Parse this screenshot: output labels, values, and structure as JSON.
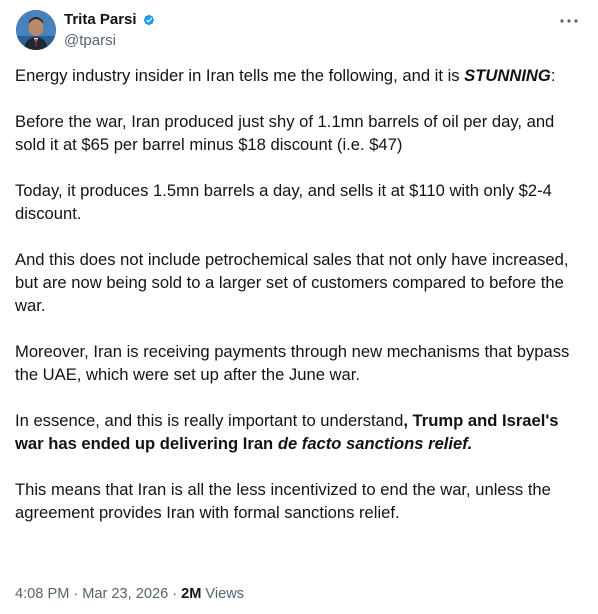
{
  "author": {
    "display_name": "Trita Parsi",
    "handle": "@tparsi",
    "verified": true,
    "verified_color": "#1d9bf0"
  },
  "icons": {
    "more": "more-horizontal-icon",
    "verified": "verified-badge-icon"
  },
  "tweet": {
    "p1_a": "Energy industry insider in Iran tells me the following, and it is ",
    "p1_b": "STUNNING",
    "p1_c": ":",
    "p2": "Before the war, Iran produced just shy of 1.1mn barrels of oil per day, and sold it at $65 per barrel minus $18 discount (i.e. $47)",
    "p3": "Today, it produces 1.5mn barrels a day, and sells it at $110 with only $2-4 discount.",
    "p4": "And this does not include petrochemical sales that not only have increased, but are now being sold to a larger set of customers compared to before the war.",
    "p5": "Moreover, Iran is receiving payments through new mechanisms that bypass the UAE, which were set up after the June war.",
    "p6_a": "In essence, and this is really important to understand",
    "p6_b": ", Trump and Israel's war has ended up delivering Iran ",
    "p6_c": "de facto sanctions relief.",
    "p7": "This means that Iran is all the less incentivized to end the war, unless the agreement provides Iran with formal sanctions relief."
  },
  "meta": {
    "time": "4:08 PM",
    "separator": "·",
    "date": "Mar 23, 2026",
    "views_count": "2M",
    "views_label": "Views"
  }
}
